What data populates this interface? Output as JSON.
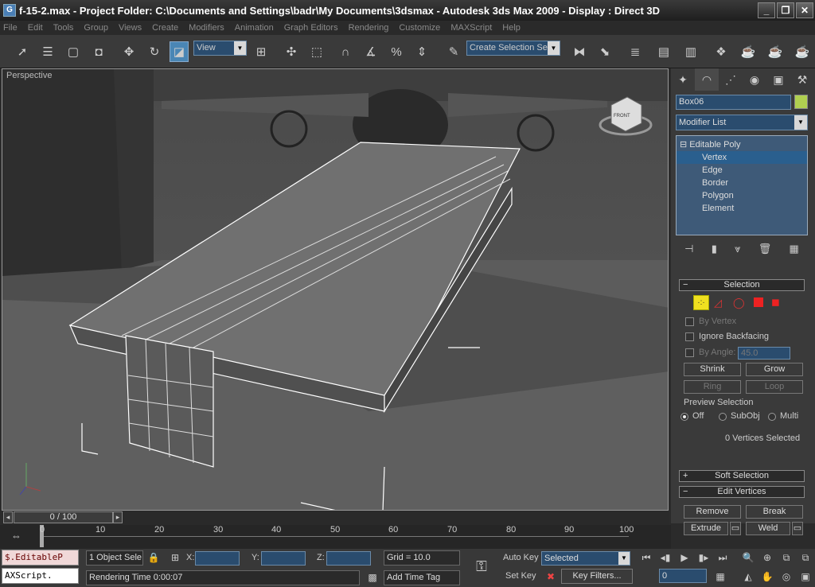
{
  "titlebar": {
    "title": "f-15-2.max     - Project Folder: C:\\Documents and Settings\\badr\\My Documents\\3dsmax     - Autodesk 3ds Max  2009     - Display : Direct 3D",
    "minimize": "_",
    "maximize": "❐",
    "close": "✕"
  },
  "menu": [
    "File",
    "Edit",
    "Tools",
    "Group",
    "Views",
    "Create",
    "Modifiers",
    "Animation",
    "Graph Editors",
    "Rendering",
    "Customize",
    "MAXScript",
    "Help"
  ],
  "toolbar": {
    "ref_coord": "View",
    "named_selection": "Create Selection Set"
  },
  "viewport": {
    "label": "Perspective",
    "viewcube_face": "FRONT"
  },
  "command_panel": {
    "object_name": "Box06",
    "object_color": "#b0d050",
    "modifier_list": "Modifier List",
    "stack": {
      "root": "Editable Poly",
      "items": [
        "Vertex",
        "Edge",
        "Border",
        "Polygon",
        "Element"
      ],
      "selected": "Vertex"
    },
    "selection_rollout": {
      "title": "Selection",
      "by_vertex": "By Vertex",
      "ignore_backfacing": "Ignore Backfacing",
      "by_angle": "By Angle:",
      "angle_value": "45.0",
      "shrink": "Shrink",
      "grow": "Grow",
      "ring": "Ring",
      "loop": "Loop",
      "preview_title": "Preview Selection",
      "preview_off": "Off",
      "preview_subobj": "SubObj",
      "preview_multi": "Multi",
      "status": "0 Vertices Selected"
    },
    "soft_selection": {
      "title": "Soft Selection",
      "sign": "+"
    },
    "edit_vertices": {
      "title": "Edit Vertices",
      "sign": "−",
      "remove": "Remove",
      "break": "Break",
      "extrude": "Extrude",
      "weld": "Weld"
    }
  },
  "timeline": {
    "frame": "0 / 100",
    "ticks": [
      "0",
      "10",
      "20",
      "30",
      "40",
      "50",
      "60",
      "70",
      "80",
      "90",
      "100"
    ]
  },
  "status": {
    "script_line1": "$.EditableP",
    "script_line2": "AXScript.",
    "objects_selected": "1 Object Sele",
    "x_label": "X:",
    "y_label": "Y:",
    "z_label": "Z:",
    "grid": "Grid = 10.0",
    "rendering_time": "Rendering Time  0:00:07",
    "add_time_tag": "Add Time Tag",
    "auto_key": "Auto Key",
    "set_key": "Set Key",
    "key_mode": "Selected",
    "key_filters": "Key Filters...",
    "current_frame": "0"
  }
}
